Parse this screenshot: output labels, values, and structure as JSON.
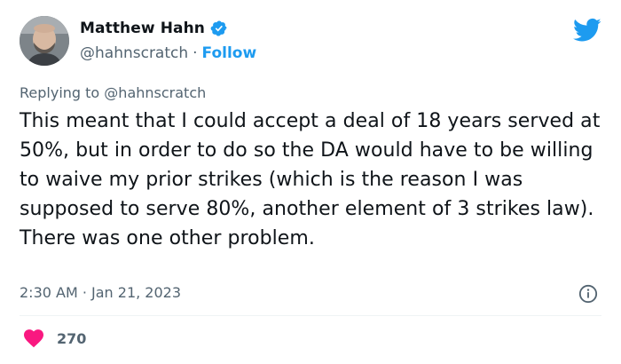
{
  "author": {
    "name": "Matthew Hahn",
    "handle": "@hahnscratch",
    "separator": "·",
    "follow_label": "Follow",
    "verified": true
  },
  "reply": {
    "prefix": "Replying to ",
    "handle": "@hahnscratch"
  },
  "tweet": {
    "text": "This meant that I could accept a deal of 18 years served at 50%, but in order to do so the DA would have to be willing to waive my prior strikes (which is the reason I was supposed to serve 80%, another element of 3 strikes law). There was one other problem.",
    "timestamp": "2:30 AM · Jan 21, 2023"
  },
  "engagement": {
    "likes": "270"
  },
  "icons": {
    "brand": "twitter-bird-icon",
    "verified": "verified-badge-icon",
    "info": "info-icon",
    "like": "heart-icon"
  },
  "colors": {
    "accent": "#1d9bf0",
    "like": "#f91880",
    "muted": "#536471",
    "text": "#0f1419"
  }
}
